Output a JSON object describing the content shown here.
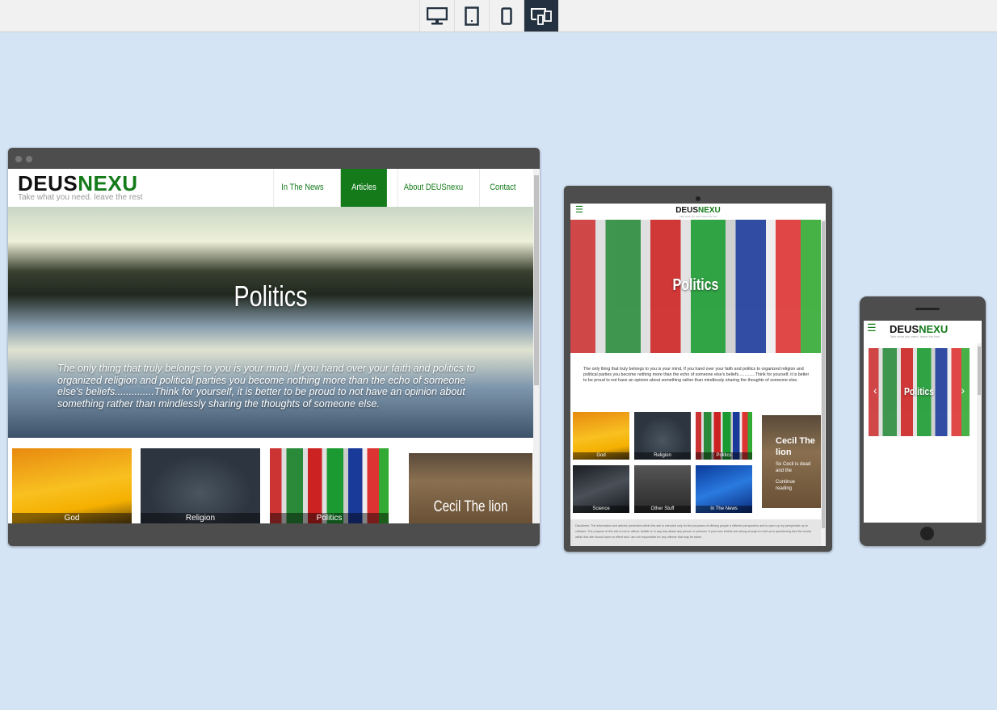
{
  "device_toolbar": {
    "buttons": [
      {
        "icon": "desktop-icon",
        "active": false
      },
      {
        "icon": "tablet-icon",
        "active": false
      },
      {
        "icon": "phone-icon",
        "active": false
      },
      {
        "icon": "responsive-icon",
        "active": true
      }
    ],
    "active_color": "#233140"
  },
  "site": {
    "logo_dark": "DEUS",
    "logo_green": "NEXU",
    "tagline": "Take what you need. leave the rest",
    "brand_color": "#147a1a",
    "nav": [
      {
        "label": "In The News",
        "active": false
      },
      {
        "label": "Articles",
        "active": true
      },
      {
        "label": "About DEUSnexu",
        "active": false
      },
      {
        "label": "Contact",
        "active": false
      }
    ],
    "hero_title": "Politics",
    "quote": "The only thing that truly belongs to you is your mind, If you hand over your faith and politics to organized religion and political parties you become nothing more than the echo of someone else's beliefs..............Think for yourself, it is better to be proud to not have an opinion about something rather than mindlessly sharing the thoughts of someone else.",
    "tiles": [
      "God",
      "Religion",
      "Politics",
      "Science",
      "Other Stuff",
      "In The News"
    ],
    "feature": {
      "title": "Cecil The lion",
      "excerpt": "So Cecil is dead and the",
      "link": "Continue reading"
    },
    "disclaimer": "Disclaimer: The information and articles presented within this site is intended only for the purposes of offering people a different perspective and to open up my perspective up to criticism. The purpose of this site is not to offend, belittle or in any way attack any person or persons. If your own beliefs are strong enough to hold up to questioning then the words within this site should have no effect and I am not responsible for any offence that may be taken."
  }
}
